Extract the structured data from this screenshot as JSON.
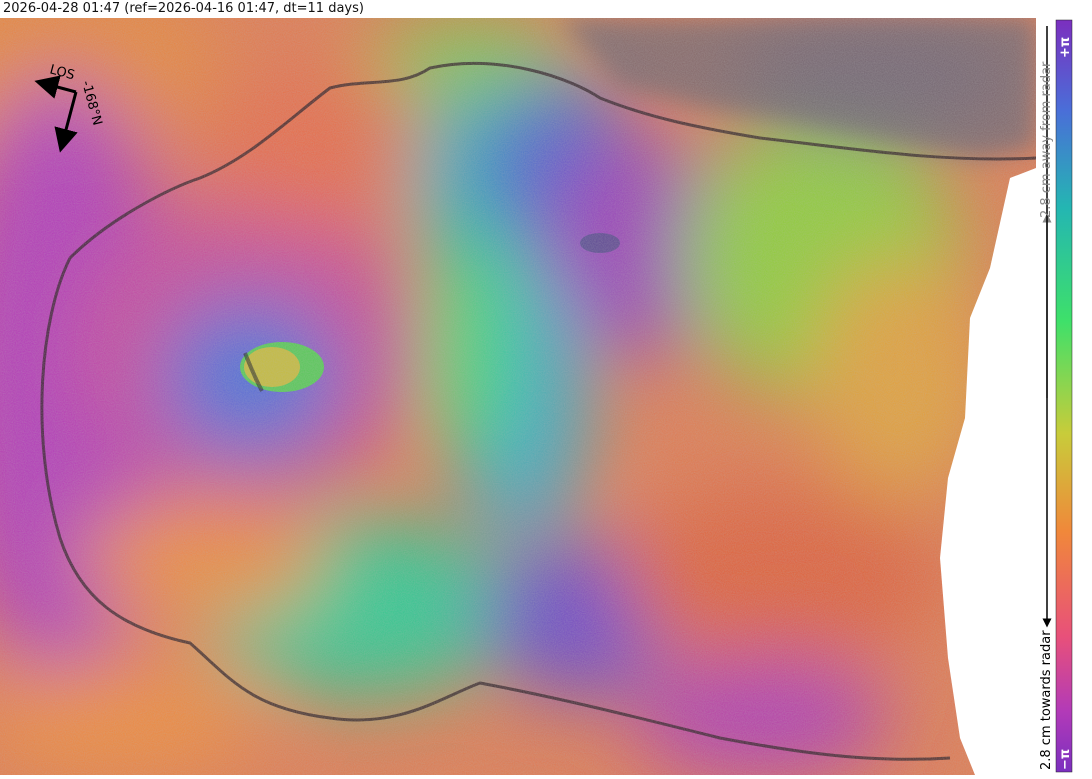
{
  "title": "2026-04-28 01:47 (ref=2026-04-16 01:47, dt=11 days)",
  "map": {
    "los_label": "LOS",
    "heading_label": "-168°N",
    "icon": "north-arrow-icon"
  },
  "colorbar": {
    "max_label": "+π",
    "min_label": "−π",
    "away_label": "2.8 cm away from radar",
    "towards_label": "2.8 cm towards radar",
    "colors": [
      "#7b2fbf",
      "#4a6ed8",
      "#24b6b2",
      "#3ee06a",
      "#c8cc3a",
      "#f0883a",
      "#e8507a",
      "#b23ab8",
      "#7b2fbf"
    ]
  }
}
